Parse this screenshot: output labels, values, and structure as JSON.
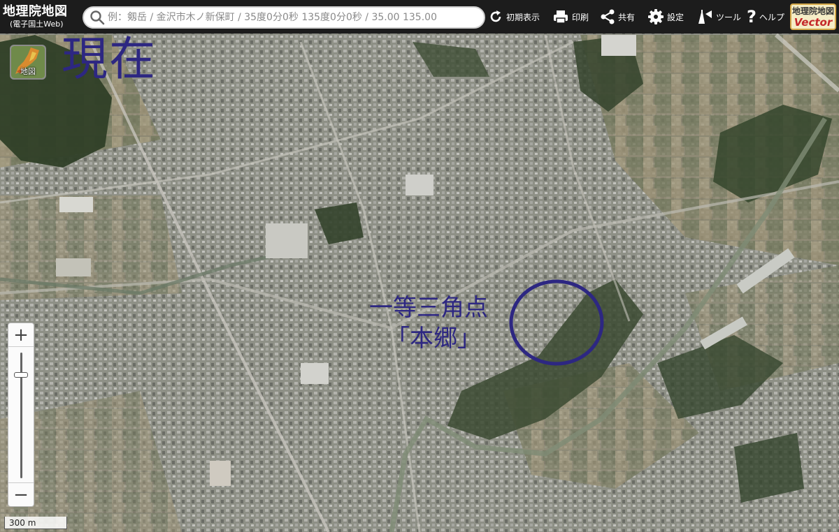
{
  "toolbar": {
    "brand_title": "地理院地図",
    "brand_subtitle": "(電子国土Web)",
    "search_placeholder": "例：剱岳 / 金沢市木ノ新保町 / 35度0分0秒 135度0分0秒 / 35.00 135.00",
    "tools": [
      {
        "label": "初期表示",
        "icon": "reload-icon"
      },
      {
        "label": "印刷",
        "icon": "printer-icon"
      },
      {
        "label": "共有",
        "icon": "share-icon"
      },
      {
        "label": "設定",
        "icon": "gear-icon"
      },
      {
        "label": "ツール",
        "icon": "tools-icon"
      },
      {
        "label": "ヘルプ",
        "icon": "help-icon"
      }
    ],
    "vector_badge_top": "地理院地図",
    "vector_badge_main": "Vector"
  },
  "layer_button": {
    "label": "地図"
  },
  "annotations": {
    "now_label": "現在",
    "point_line1": "一等三角点",
    "point_line2": "「本郷」",
    "color": "#2d2782"
  },
  "zoom": {
    "plus": "+",
    "minus": "−",
    "level_fraction": 0.18
  },
  "scale": {
    "label": "300 m"
  },
  "colors": {
    "toolbar_bg": "#1c1c1c",
    "badge_bg": "#f5edc6",
    "badge_accent": "#c4282a",
    "annotation": "#2d2782"
  }
}
